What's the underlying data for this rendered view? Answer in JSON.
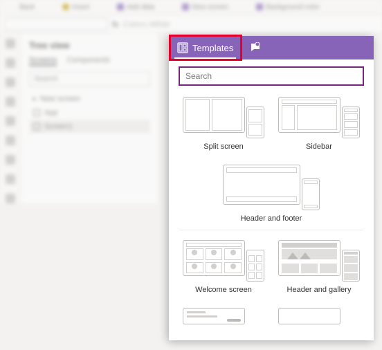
{
  "ribbon": {
    "items": [
      "Back",
      "Insert",
      "Add data",
      "New screen",
      "Background color"
    ]
  },
  "formula": {
    "value": "",
    "hint": "Colors.White"
  },
  "tree": {
    "title": "Tree view",
    "tabs": [
      "Screens",
      "Components"
    ],
    "search_placeholder": "Search",
    "items": [
      "New screen",
      "App",
      "Screen1"
    ]
  },
  "panel": {
    "colors": {
      "accent": "#8764b8",
      "highlight": "#e3002c",
      "focus": "#742774"
    },
    "tabs": {
      "templates": "Templates",
      "copilot": ""
    },
    "search_placeholder": "Search",
    "section1": [
      {
        "key": "split",
        "label": "Split screen"
      },
      {
        "key": "side",
        "label": "Sidebar"
      },
      {
        "key": "hf",
        "label": "Header and footer"
      }
    ],
    "section2": [
      {
        "key": "welcome",
        "label": "Welcome screen"
      },
      {
        "key": "gallery",
        "label": "Header and gallery"
      }
    ]
  }
}
